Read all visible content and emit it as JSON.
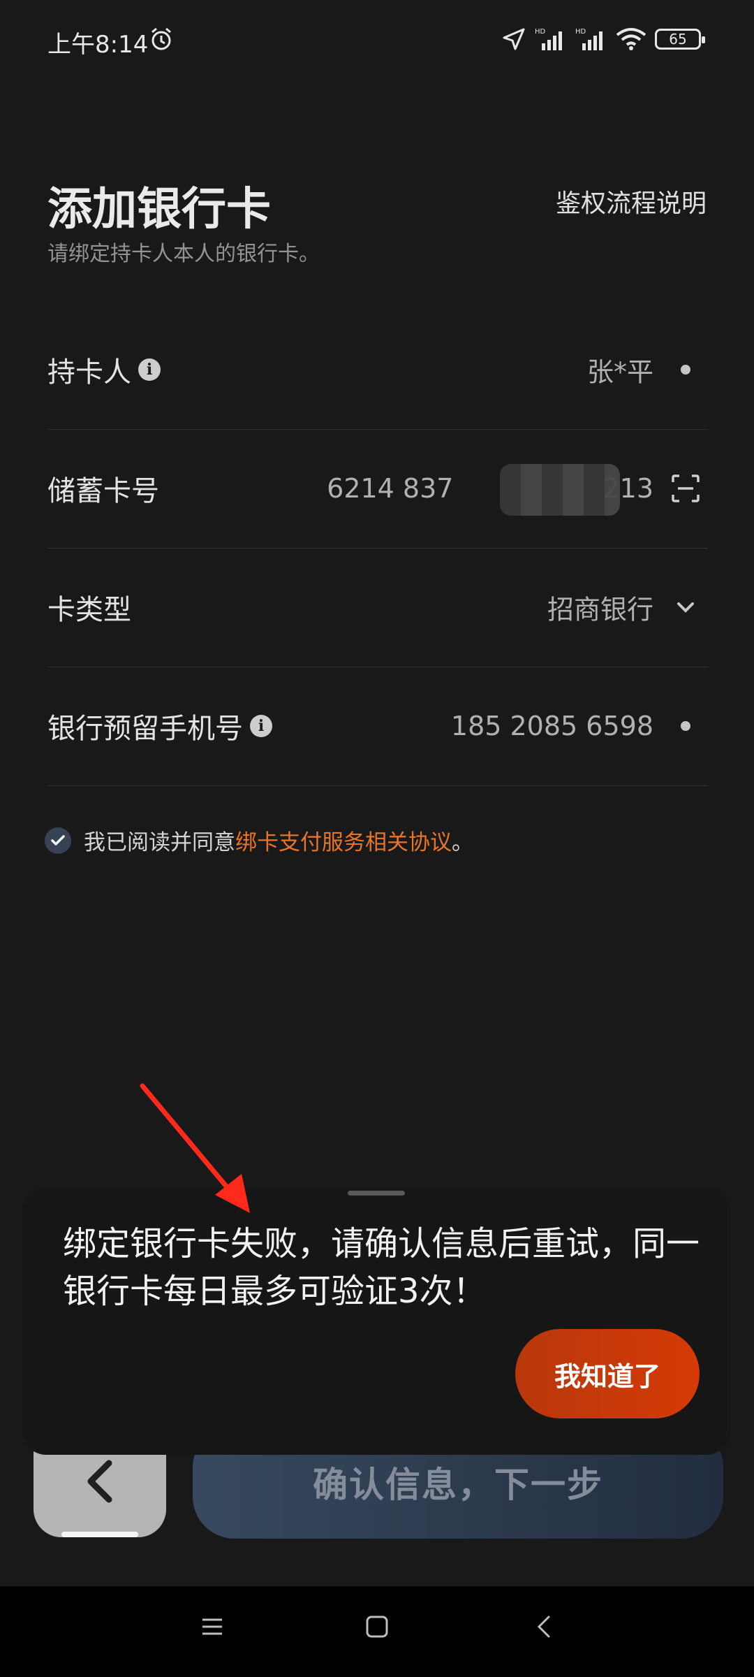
{
  "status_bar": {
    "time": "上午8:14",
    "network_label": "HD",
    "battery": "65"
  },
  "header": {
    "title": "添加银行卡",
    "subtitle": "请绑定持卡人本人的银行卡。",
    "auth_link": "鉴权流程说明"
  },
  "form": {
    "rows": [
      {
        "label": "持卡人",
        "value": "张*平",
        "info_icon": true,
        "trail": "dot"
      },
      {
        "label": "储蓄卡号",
        "value": "6214 837",
        "value_tail": "213",
        "trail": "scan-icon"
      },
      {
        "label": "卡类型",
        "value": "招商银行",
        "trail": "chevron-down-icon"
      },
      {
        "label": "银行预留手机号",
        "value": "185 2085 6598",
        "info_icon": true,
        "trail": "dot"
      }
    ]
  },
  "agreement": {
    "checked": true,
    "prefix": "我已阅读并同意",
    "link": "绑卡支付服务相关协议",
    "suffix": "。"
  },
  "bottom": {
    "next_label": "确认信息，下一步"
  },
  "sheet": {
    "message": "绑定银行卡失败，请确认信息后重试，同一银行卡每日最多可验证3次！",
    "ok_label": "我知道了"
  },
  "colors": {
    "accent_orange": "#f07a2c",
    "ok_button": "#d53a06",
    "annotation_arrow": "#ff2a1a"
  }
}
